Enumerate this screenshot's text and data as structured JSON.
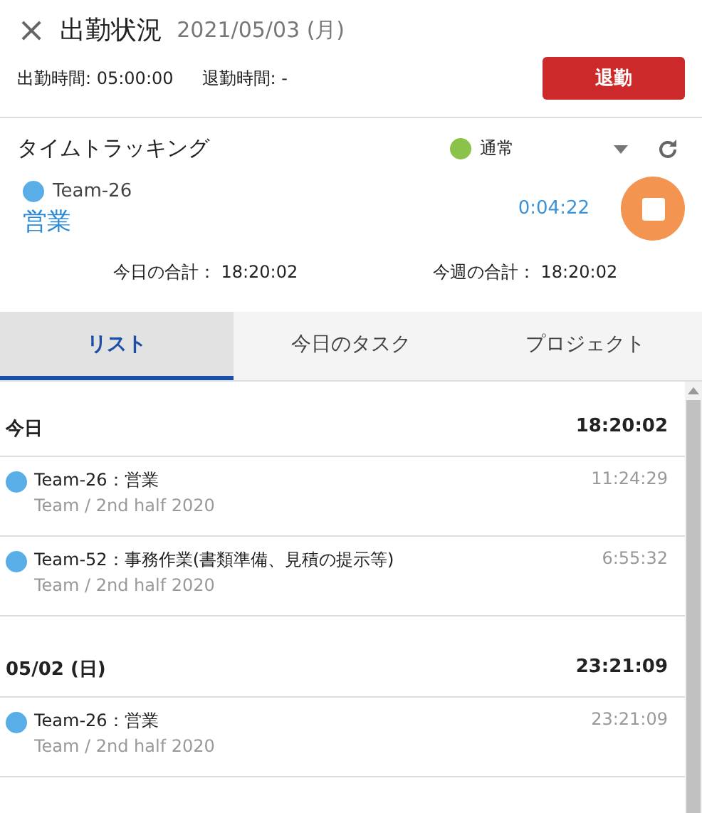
{
  "header": {
    "close": "×",
    "title": "出勤状況",
    "date": "2021/05/03 (月)",
    "clock_in": "出勤時間: 05:00:00",
    "clock_out": "退勤時間: -",
    "leave_button": "退勤"
  },
  "tracking": {
    "title": "タイムトラッキング",
    "status": {
      "label": "通常",
      "color": "#8bc34a"
    },
    "current": {
      "team": {
        "label": "Team-26",
        "color": "#5aaee8"
      },
      "task": "営業",
      "elapsed": "0:04:22",
      "running": true
    },
    "today_total": "今日の合計： 18:20:02",
    "week_total": "今週の合計： 18:20:02"
  },
  "tabs": [
    {
      "label": "リスト",
      "selected": true
    },
    {
      "label": "今日のタスク",
      "selected": false
    },
    {
      "label": "プロジェクト",
      "selected": false
    }
  ],
  "groups": [
    {
      "label": "今日",
      "total": "18:20:02",
      "entries": [
        {
          "title": "Team-26：営業",
          "project": "Team / 2nd half 2020",
          "time": "11:24:29",
          "color": "#5aaee8"
        },
        {
          "title": "Team-52：事務作業(書類準備、見積の提示等)",
          "project": "Team / 2nd half 2020",
          "time": "6:55:32",
          "color": "#5aaee8"
        }
      ]
    },
    {
      "label": "05/02 (日)",
      "total": "23:21:09",
      "entries": [
        {
          "title": "Team-26：営業",
          "project": "Team / 2nd half 2020",
          "time": "23:21:09",
          "color": "#5aaee8"
        }
      ]
    }
  ]
}
